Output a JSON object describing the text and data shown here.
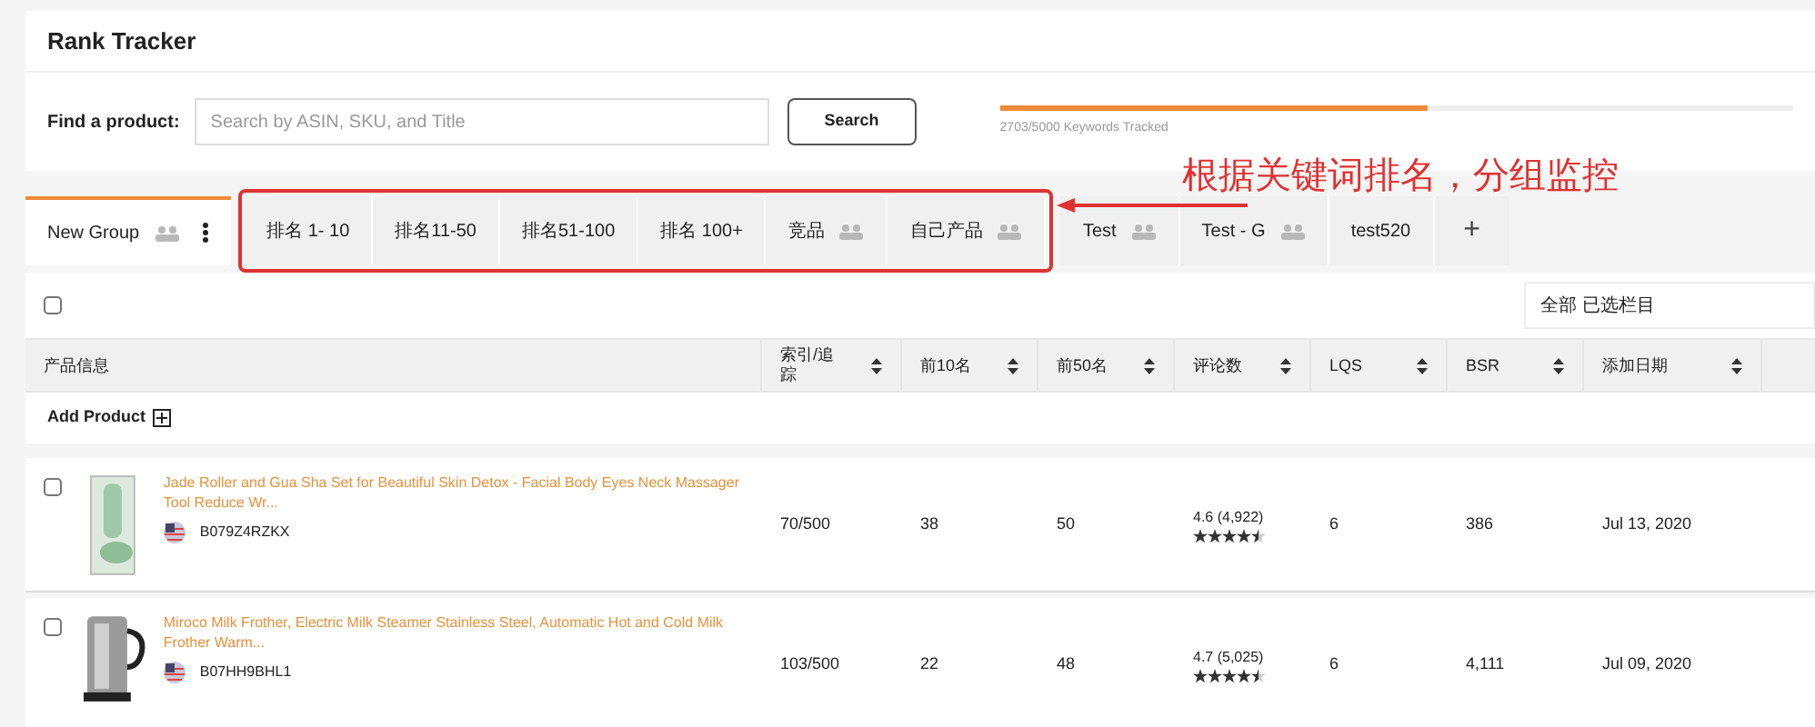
{
  "title": "Rank Tracker",
  "search": {
    "label": "Find a product:",
    "placeholder": "Search by ASIN, SKU, and Title",
    "button": "Search"
  },
  "quota": {
    "level": 0.54,
    "reading": "2703/5000 Keywords Tracked"
  },
  "annotation": {
    "text": "根据关键词排名，分组监控"
  },
  "tabs": [
    {
      "label": "New Group",
      "selected": true,
      "shared": true,
      "menu": true
    }
  ],
  "highlight_box": {
    "tabs": [
      {
        "label": "排名 1- 10",
        "selected": false,
        "shared": false,
        "menu": false
      },
      {
        "label": "排名11-50",
        "selected": false,
        "shared": false,
        "menu": false
      },
      {
        "label": "排名51-100",
        "selected": false,
        "shared": false,
        "menu": false
      },
      {
        "label": "排名 100+",
        "selected": false,
        "shared": false,
        "menu": false
      },
      {
        "label": "竞品",
        "selected": false,
        "shared": true,
        "menu": false
      },
      {
        "label": "自己产品",
        "selected": false,
        "shared": true,
        "menu": false
      }
    ]
  },
  "tabs_after": [
    {
      "label": "Test",
      "selected": false,
      "shared": true,
      "menu": false
    },
    {
      "label": "Test - G",
      "selected": false,
      "shared": true,
      "menu": false
    },
    {
      "label": "test520",
      "selected": false,
      "shared": false,
      "menu": false
    }
  ],
  "add_tab": "+",
  "select_all": {
    "checked": false
  },
  "columns_menu": "全部 已选栏目",
  "table": {
    "columns": [
      {
        "label": "产品信息",
        "sortable": false
      },
      {
        "label": "索引/追踪",
        "sortable": true
      },
      {
        "label": "前10名",
        "sortable": true
      },
      {
        "label": "前50名",
        "sortable": true
      },
      {
        "label": "评论数",
        "sortable": true
      },
      {
        "label": "LQS",
        "sortable": true
      },
      {
        "label": "BSR",
        "sortable": true
      },
      {
        "label": "添加日期",
        "sortable": true
      }
    ],
    "add_product": "Add Product",
    "rows": [
      {
        "checked": false,
        "kind": "roller",
        "title": "Jade Roller and Gua Sha Set for Beautiful Skin Detox - Facial Body Eyes Neck Massager Tool Reduce Wr...",
        "asin": "B079Z4RZKX",
        "index": "70/500",
        "top10": "38",
        "top50": "50",
        "rating": "4.6 (4,922)",
        "stars": 4.5,
        "lqs": "6",
        "bsr": "386",
        "date": "Jul 13, 2020"
      },
      {
        "checked": false,
        "kind": "frother",
        "title": "Miroco Milk Frother, Electric Milk Steamer Stainless Steel, Automatic Hot and Cold Milk Frother Warm...",
        "asin": "B07HH9BHL1",
        "index": "103/500",
        "top10": "22",
        "top50": "48",
        "rating": "4.7 (5,025)",
        "stars": 4.5,
        "lqs": "6",
        "bsr": "4,111",
        "date": "Jul 09, 2020"
      }
    ]
  }
}
